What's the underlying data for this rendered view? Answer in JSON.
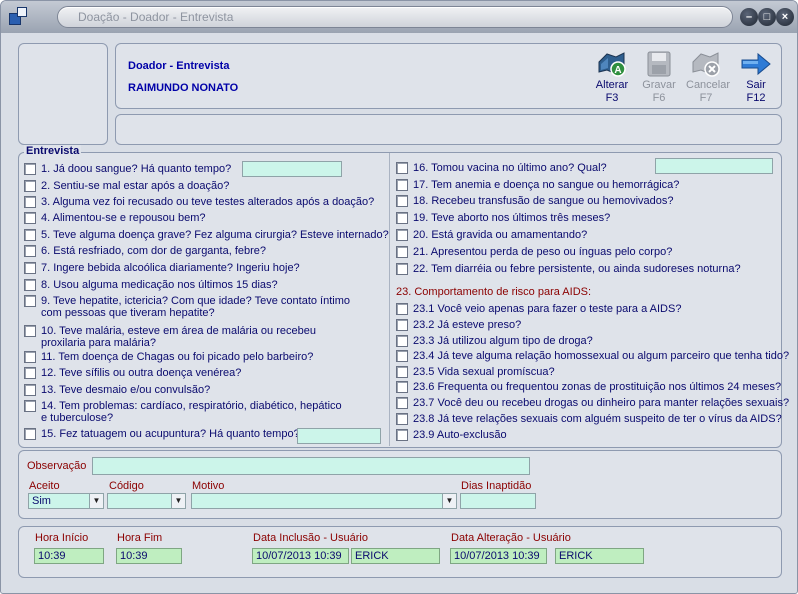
{
  "window": {
    "title": "Doação - Doador - Entrevista",
    "buttons": [
      "minimize-icon",
      "maximize-icon",
      "close-icon"
    ]
  },
  "header": {
    "title": "Doador - Entrevista",
    "donor_name": "RAIMUNDO NONATO"
  },
  "toolbar": {
    "alterar": {
      "label": "Alterar",
      "key": "F3"
    },
    "gravar": {
      "label": "Gravar",
      "key": "F6"
    },
    "cancelar": {
      "label": "Cancelar",
      "key": "F7"
    },
    "sair": {
      "label": "Sair",
      "key": "F12"
    }
  },
  "interview": {
    "legend": "Entrevista",
    "left_questions": [
      {
        "text": "1. Já doou sangue? Há quanto tempo?"
      },
      {
        "text": "2. Sentiu-se mal estar após a doação?"
      },
      {
        "text": "3. Alguma vez foi recusado ou teve testes alterados após a doação?"
      },
      {
        "text": "4. Alimentou-se e repousou bem?"
      },
      {
        "text": "5. Teve alguma doença grave? Fez alguma cirurgia? Esteve internado?"
      },
      {
        "text": "6. Está resfriado, com dor de garganta, febre?"
      },
      {
        "text": "7. Ingere bebida alcoólica diariamente? Ingeriu hoje?"
      },
      {
        "text": "8. Usou alguma medicação nos últimos 15 dias?"
      },
      {
        "text": "9. Teve hepatite, ictericia? Com que idade? Teve contato íntimo com pessoas que tiveram hepatite?"
      },
      {
        "text": "10. Teve malária, esteve em área de malária ou recebeu proxilaria para malária?"
      },
      {
        "text": "11. Tem doença de Chagas ou foi picado pelo barbeiro?"
      },
      {
        "text": "12. Teve sífilis ou outra doença venérea?"
      },
      {
        "text": "13. Teve desmaio e/ou convulsão?"
      },
      {
        "text": "14. Tem problemas: cardíaco, respiratório, diabético, hepático e tuberculose?"
      },
      {
        "text": "15. Fez tatuagem ou acupuntura? Há quanto tempo?"
      }
    ],
    "right_questions": [
      {
        "text": "16. Tomou vacina no último ano? Qual?"
      },
      {
        "text": "17. Tem anemia e doença no sangue ou hemorrágica?"
      },
      {
        "text": "18. Recebeu transfusão de sangue ou hemovivados?"
      },
      {
        "text": "19. Teve aborto nos últimos três meses?"
      },
      {
        "text": "20. Está gravida ou amamentando?"
      },
      {
        "text": "21. Apresentou perda de peso ou ínguas pelo corpo?"
      },
      {
        "text": "22. Tem diarréia ou febre persistente, ou ainda sudoreses noturna?"
      }
    ],
    "aids_section_title": "23. Comportamento de risco para AIDS:",
    "aids_questions": [
      {
        "text": "23.1 Você veio apenas para fazer o teste para a AIDS?"
      },
      {
        "text": "23.2 Já esteve preso?"
      },
      {
        "text": "23.3 Já utilizou algum tipo de droga?"
      },
      {
        "text": "23.4 Já teve alguma relação homossexual ou algum parceiro que tenha tido?"
      },
      {
        "text": "23.5 Vida sexual promíscua?"
      },
      {
        "text": "23.6 Frequenta ou frequentou zonas de prostituição nos últimos 24 meses?"
      },
      {
        "text": "23.7 Você deu ou recebeu drogas ou dinheiro para manter relações sexuais?"
      },
      {
        "text": "23.8 Já teve relações sexuais com alguém suspeito de ter o vírus da AIDS?"
      },
      {
        "text": "23.9 Auto-exclusão"
      }
    ]
  },
  "form": {
    "observacao_label": "Observação",
    "aceito_label": "Aceito",
    "aceito_value": "Sim",
    "codigo_label": "Código",
    "codigo_value": "",
    "motivo_label": "Motivo",
    "motivo_value": "",
    "dias_label": "Dias Inaptidão",
    "dias_value": ""
  },
  "footer": {
    "hora_inicio_label": "Hora Início",
    "hora_inicio": "10:39",
    "hora_fim_label": "Hora Fim",
    "hora_fim": "10:39",
    "data_inclusao_label": "Data Inclusão - Usuário",
    "data_inclusao": "10/07/2013 10:39",
    "usuario_inclusao": "ERICK",
    "data_alteracao_label": "Data Alteração - Usuário",
    "data_alteracao": "10/07/2013 10:39",
    "usuario_alteracao": "ERICK"
  }
}
